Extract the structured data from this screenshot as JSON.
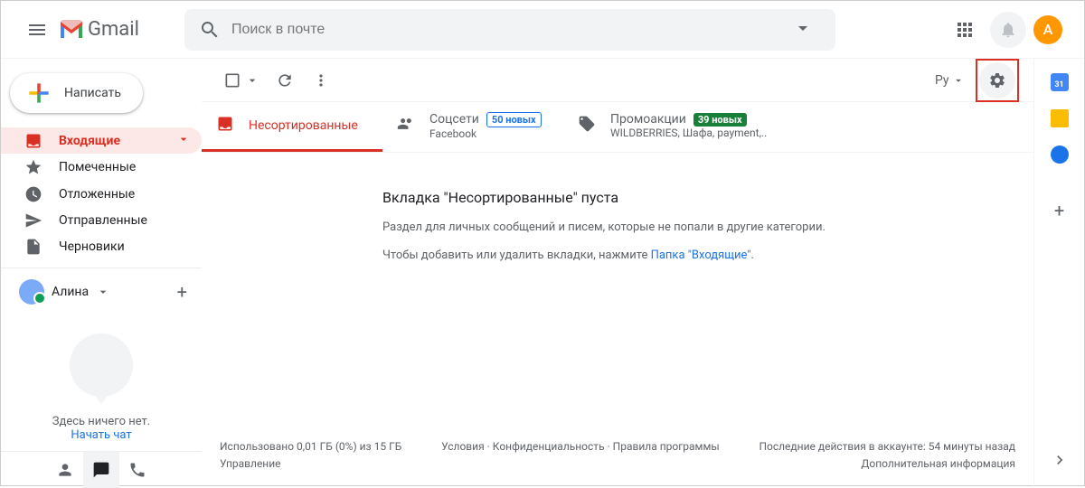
{
  "header": {
    "logo_text": "Gmail",
    "search_placeholder": "Поиск в почте",
    "avatar_letter": "A"
  },
  "sidebar": {
    "compose": "Написать",
    "items": [
      {
        "label": "Входящие",
        "icon": "inbox"
      },
      {
        "label": "Помеченные",
        "icon": "star"
      },
      {
        "label": "Отложенные",
        "icon": "clock"
      },
      {
        "label": "Отправленные",
        "icon": "send"
      },
      {
        "label": "Черновики",
        "icon": "draft"
      }
    ],
    "hangouts_user": "Алина",
    "hangouts_empty": "Здесь ничего нет.",
    "hangouts_start": "Начать чат"
  },
  "toolbar": {
    "lang": "Ру"
  },
  "tabs": [
    {
      "label": "Несортированные",
      "sub": "",
      "badge": "",
      "badge_class": ""
    },
    {
      "label": "Соцсети",
      "sub": "Facebook",
      "badge": "50 новых",
      "badge_class": "badge-blue"
    },
    {
      "label": "Промоакции",
      "sub": "WILDBERRIES, Шафа, payment,..",
      "badge": "39 новых",
      "badge_class": "badge-green"
    }
  ],
  "empty": {
    "title": "Вкладка \"Несортированные\" пуста",
    "desc": "Раздел для личных сообщений и писем, которые не попали в другие категории.",
    "hint_prefix": "Чтобы добавить или удалить вкладки, нажмите ",
    "hint_link": "Папка \"Входящие\"",
    "hint_suffix": "."
  },
  "footer": {
    "storage": "Использовано 0,01 ГБ (0%) из 15 ГБ",
    "manage": "Управление",
    "terms": "Условия · Конфиденциальность · Правила программы",
    "activity": "Последние действия в аккаунте: 54 минуты назад",
    "details": "Дополнительная информация"
  },
  "sidepanel": {
    "calendar_day": "31"
  }
}
